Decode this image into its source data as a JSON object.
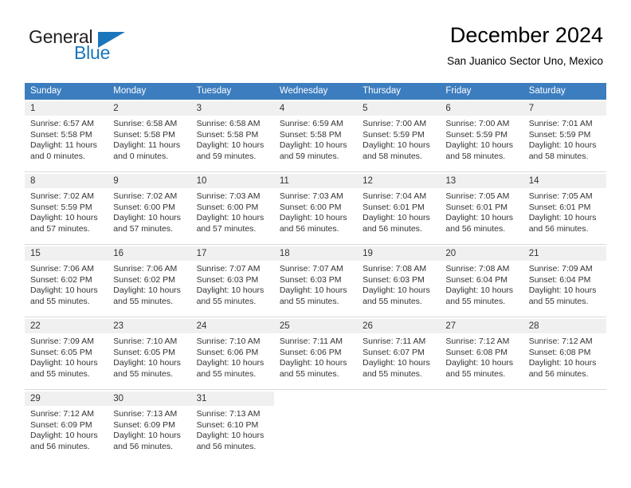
{
  "brand": {
    "name_part1": "General",
    "name_part2": "Blue"
  },
  "header": {
    "title": "December 2024",
    "subtitle": "San Juanico Sector Uno, Mexico"
  },
  "calendar": {
    "weekdays": [
      "Sunday",
      "Monday",
      "Tuesday",
      "Wednesday",
      "Thursday",
      "Friday",
      "Saturday"
    ],
    "accent_color": "#3c7dbf",
    "day_number_bg": "#f0f0f0",
    "weeks": [
      [
        {
          "day": "1",
          "sunrise": "Sunrise: 6:57 AM",
          "sunset": "Sunset: 5:58 PM",
          "daylight1": "Daylight: 11 hours",
          "daylight2": "and 0 minutes."
        },
        {
          "day": "2",
          "sunrise": "Sunrise: 6:58 AM",
          "sunset": "Sunset: 5:58 PM",
          "daylight1": "Daylight: 11 hours",
          "daylight2": "and 0 minutes."
        },
        {
          "day": "3",
          "sunrise": "Sunrise: 6:58 AM",
          "sunset": "Sunset: 5:58 PM",
          "daylight1": "Daylight: 10 hours",
          "daylight2": "and 59 minutes."
        },
        {
          "day": "4",
          "sunrise": "Sunrise: 6:59 AM",
          "sunset": "Sunset: 5:58 PM",
          "daylight1": "Daylight: 10 hours",
          "daylight2": "and 59 minutes."
        },
        {
          "day": "5",
          "sunrise": "Sunrise: 7:00 AM",
          "sunset": "Sunset: 5:59 PM",
          "daylight1": "Daylight: 10 hours",
          "daylight2": "and 58 minutes."
        },
        {
          "day": "6",
          "sunrise": "Sunrise: 7:00 AM",
          "sunset": "Sunset: 5:59 PM",
          "daylight1": "Daylight: 10 hours",
          "daylight2": "and 58 minutes."
        },
        {
          "day": "7",
          "sunrise": "Sunrise: 7:01 AM",
          "sunset": "Sunset: 5:59 PM",
          "daylight1": "Daylight: 10 hours",
          "daylight2": "and 58 minutes."
        }
      ],
      [
        {
          "day": "8",
          "sunrise": "Sunrise: 7:02 AM",
          "sunset": "Sunset: 5:59 PM",
          "daylight1": "Daylight: 10 hours",
          "daylight2": "and 57 minutes."
        },
        {
          "day": "9",
          "sunrise": "Sunrise: 7:02 AM",
          "sunset": "Sunset: 6:00 PM",
          "daylight1": "Daylight: 10 hours",
          "daylight2": "and 57 minutes."
        },
        {
          "day": "10",
          "sunrise": "Sunrise: 7:03 AM",
          "sunset": "Sunset: 6:00 PM",
          "daylight1": "Daylight: 10 hours",
          "daylight2": "and 57 minutes."
        },
        {
          "day": "11",
          "sunrise": "Sunrise: 7:03 AM",
          "sunset": "Sunset: 6:00 PM",
          "daylight1": "Daylight: 10 hours",
          "daylight2": "and 56 minutes."
        },
        {
          "day": "12",
          "sunrise": "Sunrise: 7:04 AM",
          "sunset": "Sunset: 6:01 PM",
          "daylight1": "Daylight: 10 hours",
          "daylight2": "and 56 minutes."
        },
        {
          "day": "13",
          "sunrise": "Sunrise: 7:05 AM",
          "sunset": "Sunset: 6:01 PM",
          "daylight1": "Daylight: 10 hours",
          "daylight2": "and 56 minutes."
        },
        {
          "day": "14",
          "sunrise": "Sunrise: 7:05 AM",
          "sunset": "Sunset: 6:01 PM",
          "daylight1": "Daylight: 10 hours",
          "daylight2": "and 56 minutes."
        }
      ],
      [
        {
          "day": "15",
          "sunrise": "Sunrise: 7:06 AM",
          "sunset": "Sunset: 6:02 PM",
          "daylight1": "Daylight: 10 hours",
          "daylight2": "and 55 minutes."
        },
        {
          "day": "16",
          "sunrise": "Sunrise: 7:06 AM",
          "sunset": "Sunset: 6:02 PM",
          "daylight1": "Daylight: 10 hours",
          "daylight2": "and 55 minutes."
        },
        {
          "day": "17",
          "sunrise": "Sunrise: 7:07 AM",
          "sunset": "Sunset: 6:03 PM",
          "daylight1": "Daylight: 10 hours",
          "daylight2": "and 55 minutes."
        },
        {
          "day": "18",
          "sunrise": "Sunrise: 7:07 AM",
          "sunset": "Sunset: 6:03 PM",
          "daylight1": "Daylight: 10 hours",
          "daylight2": "and 55 minutes."
        },
        {
          "day": "19",
          "sunrise": "Sunrise: 7:08 AM",
          "sunset": "Sunset: 6:03 PM",
          "daylight1": "Daylight: 10 hours",
          "daylight2": "and 55 minutes."
        },
        {
          "day": "20",
          "sunrise": "Sunrise: 7:08 AM",
          "sunset": "Sunset: 6:04 PM",
          "daylight1": "Daylight: 10 hours",
          "daylight2": "and 55 minutes."
        },
        {
          "day": "21",
          "sunrise": "Sunrise: 7:09 AM",
          "sunset": "Sunset: 6:04 PM",
          "daylight1": "Daylight: 10 hours",
          "daylight2": "and 55 minutes."
        }
      ],
      [
        {
          "day": "22",
          "sunrise": "Sunrise: 7:09 AM",
          "sunset": "Sunset: 6:05 PM",
          "daylight1": "Daylight: 10 hours",
          "daylight2": "and 55 minutes."
        },
        {
          "day": "23",
          "sunrise": "Sunrise: 7:10 AM",
          "sunset": "Sunset: 6:05 PM",
          "daylight1": "Daylight: 10 hours",
          "daylight2": "and 55 minutes."
        },
        {
          "day": "24",
          "sunrise": "Sunrise: 7:10 AM",
          "sunset": "Sunset: 6:06 PM",
          "daylight1": "Daylight: 10 hours",
          "daylight2": "and 55 minutes."
        },
        {
          "day": "25",
          "sunrise": "Sunrise: 7:11 AM",
          "sunset": "Sunset: 6:06 PM",
          "daylight1": "Daylight: 10 hours",
          "daylight2": "and 55 minutes."
        },
        {
          "day": "26",
          "sunrise": "Sunrise: 7:11 AM",
          "sunset": "Sunset: 6:07 PM",
          "daylight1": "Daylight: 10 hours",
          "daylight2": "and 55 minutes."
        },
        {
          "day": "27",
          "sunrise": "Sunrise: 7:12 AM",
          "sunset": "Sunset: 6:08 PM",
          "daylight1": "Daylight: 10 hours",
          "daylight2": "and 55 minutes."
        },
        {
          "day": "28",
          "sunrise": "Sunrise: 7:12 AM",
          "sunset": "Sunset: 6:08 PM",
          "daylight1": "Daylight: 10 hours",
          "daylight2": "and 56 minutes."
        }
      ],
      [
        {
          "day": "29",
          "sunrise": "Sunrise: 7:12 AM",
          "sunset": "Sunset: 6:09 PM",
          "daylight1": "Daylight: 10 hours",
          "daylight2": "and 56 minutes."
        },
        {
          "day": "30",
          "sunrise": "Sunrise: 7:13 AM",
          "sunset": "Sunset: 6:09 PM",
          "daylight1": "Daylight: 10 hours",
          "daylight2": "and 56 minutes."
        },
        {
          "day": "31",
          "sunrise": "Sunrise: 7:13 AM",
          "sunset": "Sunset: 6:10 PM",
          "daylight1": "Daylight: 10 hours",
          "daylight2": "and 56 minutes."
        },
        {
          "day": "",
          "sunrise": "",
          "sunset": "",
          "daylight1": "",
          "daylight2": ""
        },
        {
          "day": "",
          "sunrise": "",
          "sunset": "",
          "daylight1": "",
          "daylight2": ""
        },
        {
          "day": "",
          "sunrise": "",
          "sunset": "",
          "daylight1": "",
          "daylight2": ""
        },
        {
          "day": "",
          "sunrise": "",
          "sunset": "",
          "daylight1": "",
          "daylight2": ""
        }
      ]
    ]
  }
}
